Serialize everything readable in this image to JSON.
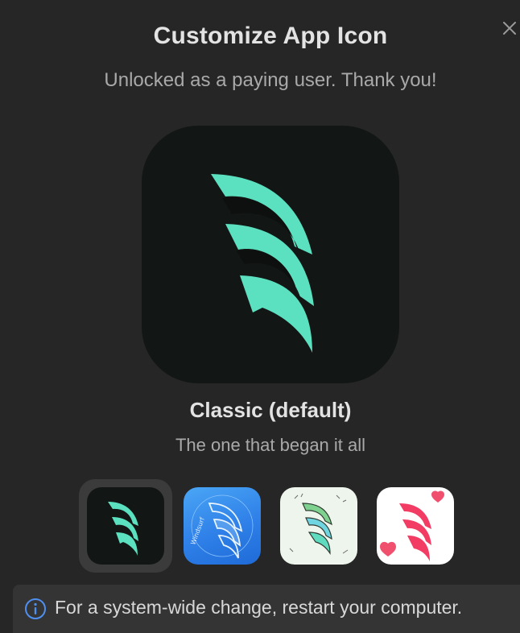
{
  "dialog": {
    "title": "Customize App Icon",
    "subtitle": "Unlocked as a paying user. Thank you!",
    "close_icon": "close-icon"
  },
  "selected_icon": {
    "name": "Classic (default)",
    "description": "The one that began it all",
    "accent_color": "#5ce1c0",
    "background_color": "#121614"
  },
  "icon_options": [
    {
      "id": "classic",
      "icon": "windsurf-classic-icon",
      "selected": true
    },
    {
      "id": "blueprint",
      "icon": "windsurf-blueprint-icon",
      "selected": false,
      "tile_text": "Windsurf"
    },
    {
      "id": "sketch",
      "icon": "windsurf-sketch-icon",
      "selected": false
    },
    {
      "id": "hearts",
      "icon": "windsurf-hearts-icon",
      "selected": false
    }
  ],
  "info": {
    "icon": "info-icon",
    "text": "For a system-wide change, restart your computer."
  }
}
